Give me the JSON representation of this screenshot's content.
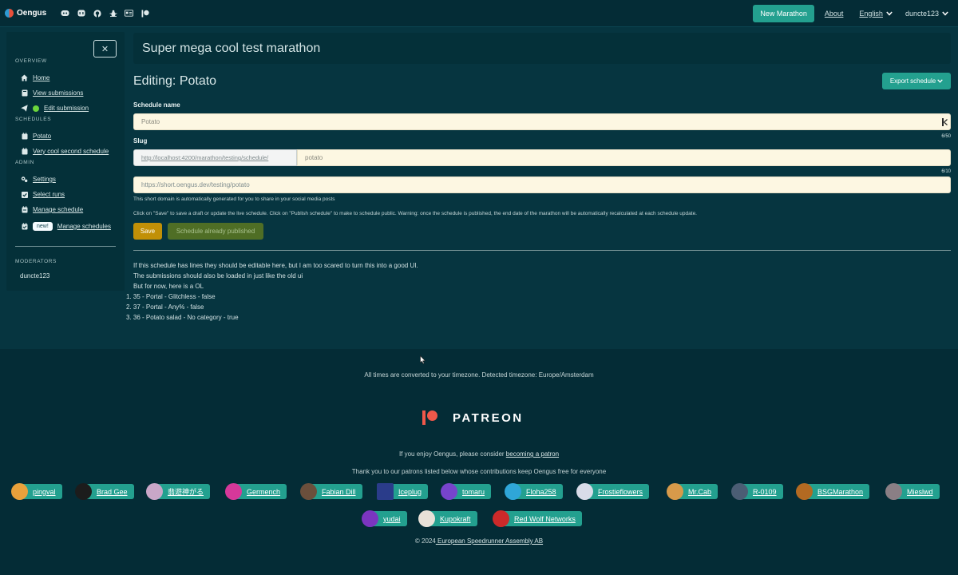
{
  "navbar": {
    "brand": "Oengus",
    "icons": [
      "discord-icon",
      "mastodon-icon",
      "github-icon",
      "bug-icon",
      "id-card-icon",
      "patreon-icon"
    ],
    "new_marathon": "New Marathon",
    "about": "About",
    "language": "English",
    "user": "duncte123"
  },
  "sidebar": {
    "overview_label": "OVERVIEW",
    "overview_items": [
      {
        "label": "Home",
        "icon": "home-icon"
      },
      {
        "label": "View submissions",
        "icon": "book-icon"
      },
      {
        "label": "Edit submission",
        "icon": "paper-plane-icon"
      }
    ],
    "schedules_label": "SCHEDULES",
    "schedule_items": [
      {
        "label": "Potato",
        "icon": "calendar-icon"
      },
      {
        "label": "Very cool second schedule",
        "icon": "calendar-icon"
      }
    ],
    "admin_label": "ADMIN",
    "admin_items": [
      {
        "label": "Settings",
        "icon": "cogs-icon"
      },
      {
        "label": "Select runs",
        "icon": "check-square-icon"
      },
      {
        "label": "Manage schedule",
        "icon": "calendar-edit-icon"
      },
      {
        "label": "Manage schedules",
        "icon": "calendar-check-icon",
        "badge": "new!"
      }
    ],
    "moderators_label": "MODERATORS",
    "moderator": "duncte123"
  },
  "main": {
    "marathon_title": "Super mega cool test marathon",
    "edit_title": "Editing: Potato",
    "export_button": "Export schedule",
    "schedule_name_label": "Schedule name",
    "schedule_name_value": "Potato",
    "schedule_name_counter": "6/50",
    "slug_label": "Slug",
    "slug_prefix": "http://localhost:4200/marathon/testing/schedule/",
    "slug_value": "potato",
    "slug_counter": "6/10",
    "short_url": "https://short.oengus.dev/testing/potato",
    "short_help": "This short domain is automatically generated for you to share in your social media posts",
    "save_help": "Click on \"Save\" to save a draft or update the live schedule. Click on \"Publish schedule\" to make to schedule public. Warning: once the schedule is published, the end date of the marathon will be automatically recalculated at each schedule update.",
    "save_button": "Save",
    "published_button": "Schedule already published",
    "para1": "If this schedule has lines they should be editable here, but I am too scared to turn this into a good UI.",
    "para2": "The submissions should also be loaded in just like the old ui",
    "para3": "But for now, here is a OL",
    "list": [
      "35 - Portal - Glitchless - false",
      "37 - Portal - Any% - false",
      "36 - Potato salad - No category - true"
    ]
  },
  "footer": {
    "timezone": "All times are converted to your timezone. Detected timezone: Europe/Amsterdam",
    "patreon_word": "PATREON",
    "enjoy_prefix": "If you enjoy Oengus, please consider ",
    "enjoy_link": "becoming a patron",
    "thanks": "Thank you to our patrons listed below whose contributions keep Oengus free for everyone",
    "patrons": [
      {
        "name": "pingval",
        "color": "#e9a13b"
      },
      {
        "name": "Brad Gee",
        "color": "#1c1c1c"
      },
      {
        "name": "翡遊神がる",
        "color": "#c9a7c8"
      },
      {
        "name": "Germench",
        "color": "#d6389a"
      },
      {
        "name": "Fabian Dill",
        "color": "#6b4f3c"
      },
      {
        "name": "Iceplug",
        "color": "#2a3c8a"
      },
      {
        "name": "tomaru",
        "color": "#7744cc"
      },
      {
        "name": "Floha258",
        "color": "#2fa6d8"
      },
      {
        "name": "Frostieflowers",
        "color": "#d8dce8"
      },
      {
        "name": "Mr.Cab",
        "color": "#d79a4a"
      },
      {
        "name": "R-0109",
        "color": "#4b5d74"
      },
      {
        "name": "BSGMarathon",
        "color": "#b36a22"
      },
      {
        "name": "Mieslwd",
        "color": "#8a7f85"
      },
      {
        "name": "yudai",
        "color": "#7b35c0"
      },
      {
        "name": "Kupokraft",
        "color": "#e8e1d8"
      },
      {
        "name": "Red Wolf Networks",
        "color": "#cc2a2a"
      }
    ],
    "copyright_prefix": "© 2024",
    "copyright_link": " European Speedrunner Assembly AB"
  }
}
